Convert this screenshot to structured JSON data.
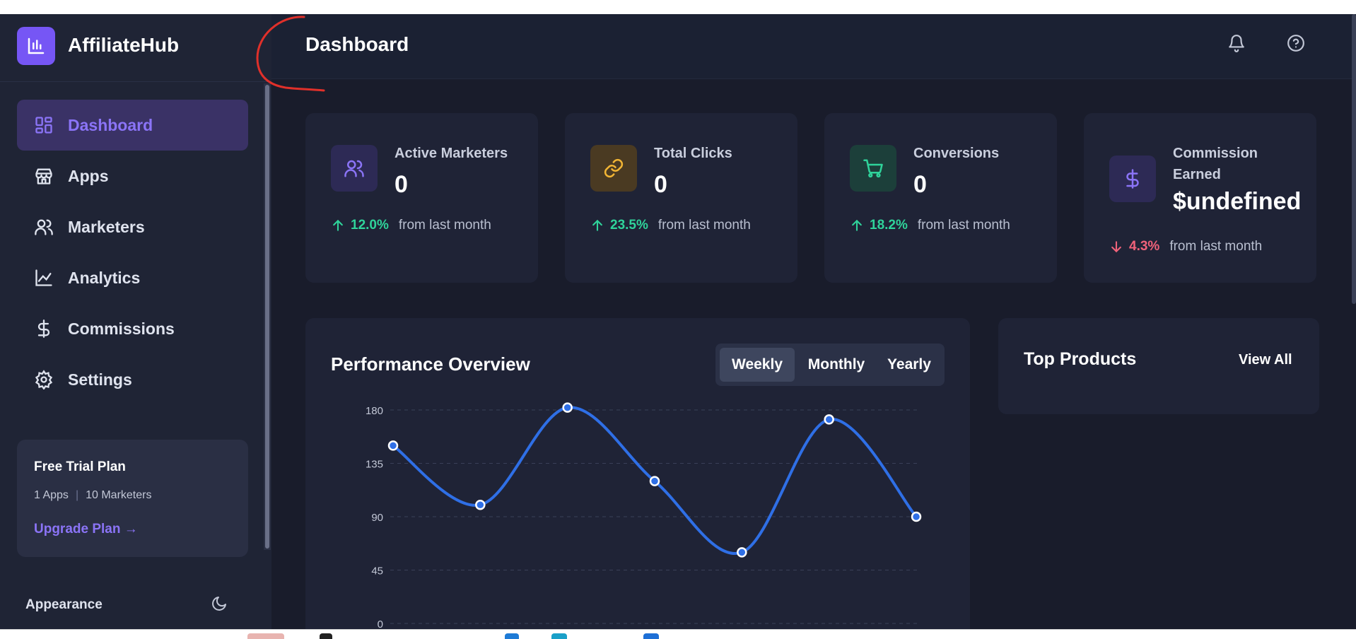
{
  "brand": {
    "name": "AffiliateHub",
    "logo_icon": "bar-chart-icon",
    "accent": "#7656f5"
  },
  "sidebar": {
    "items": [
      {
        "label": "Dashboard",
        "icon": "grid-icon",
        "active": true
      },
      {
        "label": "Apps",
        "icon": "store-icon",
        "active": false
      },
      {
        "label": "Marketers",
        "icon": "users-icon",
        "active": false
      },
      {
        "label": "Analytics",
        "icon": "line-chart-icon",
        "active": false
      },
      {
        "label": "Commissions",
        "icon": "dollar-icon",
        "active": false
      },
      {
        "label": "Settings",
        "icon": "gear-icon",
        "active": false
      }
    ],
    "plan": {
      "title": "Free Trial Plan",
      "apps": "1 Apps",
      "separator": "|",
      "marketers": "10 Marketers",
      "upgrade_label": "Upgrade Plan →"
    },
    "appearance": {
      "label": "Appearance",
      "icon": "moon-icon"
    }
  },
  "header": {
    "title": "Dashboard",
    "icons": [
      "bell-icon",
      "help-icon"
    ]
  },
  "stats": [
    {
      "label": "Active Marketers",
      "value": "0",
      "direction": "up",
      "change": "12.0%",
      "suffix": "from last month",
      "icon": "users-icon",
      "color": "#8b74f7"
    },
    {
      "label": "Total Clicks",
      "value": "0",
      "direction": "up",
      "change": "23.5%",
      "suffix": "from last month",
      "icon": "link-icon",
      "color": "#f2b534"
    },
    {
      "label": "Conversions",
      "value": "0",
      "direction": "up",
      "change": "18.2%",
      "suffix": "from last month",
      "icon": "cart-icon",
      "color": "#2fd39a"
    },
    {
      "label": "Commission Earned",
      "value": "$undefined",
      "direction": "down",
      "change": "4.3%",
      "suffix": "from last month",
      "icon": "dollar-icon",
      "color": "#8b74f7"
    }
  ],
  "performance": {
    "title": "Performance Overview",
    "tabs": [
      {
        "label": "Weekly",
        "active": true
      },
      {
        "label": "Monthly",
        "active": false
      },
      {
        "label": "Yearly",
        "active": false
      }
    ]
  },
  "top_products": {
    "title": "Top Products",
    "link_label": "View All"
  },
  "chart_data": {
    "type": "line",
    "x": [
      1,
      2,
      3,
      4,
      5,
      6,
      7
    ],
    "series": [
      {
        "values": [
          150,
          100,
          182,
          120,
          60,
          172,
          90
        ],
        "color": "#2f6fe6"
      }
    ],
    "yticks": [
      "180",
      "135",
      "90",
      "45",
      "0"
    ],
    "ylim": [
      0,
      180
    ],
    "grid": true,
    "title": "",
    "xlabel": "",
    "ylabel": ""
  }
}
